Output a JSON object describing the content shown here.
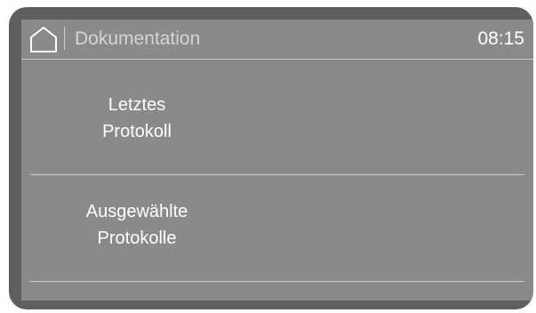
{
  "header": {
    "home_icon": "home-icon",
    "title": "Dokumentation",
    "time": "08:15"
  },
  "menu": {
    "items": [
      {
        "line1": "Letztes",
        "line2": "Protokoll"
      },
      {
        "line1": "Ausgewählte",
        "line2": "Protokolle"
      }
    ]
  },
  "colors": {
    "frame": "#5e5e5e",
    "screen_background": "#8a8a8a",
    "divider": "#cfcfcf",
    "text": "#ffffff"
  }
}
